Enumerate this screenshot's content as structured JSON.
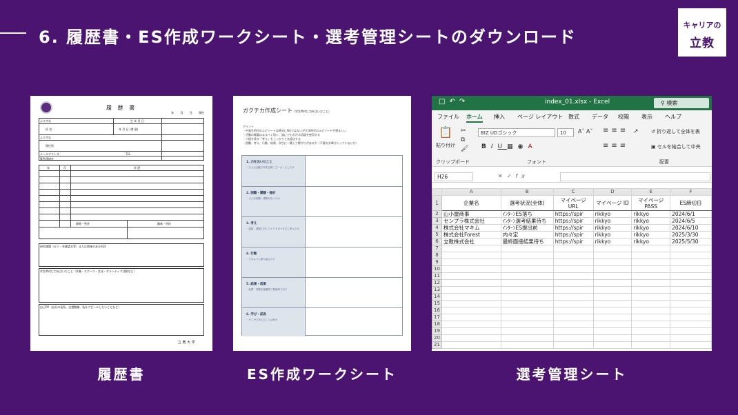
{
  "slide": {
    "title": "6. 履歴書・ES作成ワークシート・選考管理シートのダウンロード",
    "logo_line1": "キャリアの",
    "logo_line2": "立教"
  },
  "captions": {
    "resume": "履歴書",
    "es_sheet": "ES作成ワークシート",
    "tracker": "選考管理シート"
  },
  "resume": {
    "heading": "履 歴 書",
    "date": "年 月 日 現在",
    "furigana": "ふりがな",
    "name": "氏 名",
    "birth": "生 年 月 日",
    "birth_fields": "年 月 日 (満 歳)",
    "address": "現住所",
    "email": "メールアドレス",
    "tel": "TEL",
    "emergency": "緊急連絡先",
    "table_year": "年",
    "table_month": "月",
    "table_history": "学 歴",
    "license": "資格・免許",
    "hobby": "趣味・特技",
    "seminar": "研究課題（ゼミ・卒業論文等）または興味のある科目",
    "gakuchika": "学生時代に力を注いだこと（学業・スポーツ・文化・ボランティア活動など）",
    "self_pr": "自己PR（自分の長所、志望動機、私をアピールしたいことなど）",
    "university": "立 教 大 学"
  },
  "es": {
    "title": "ガクチカ作成シート",
    "subtitle": "（学生時代に力を注いだこと）",
    "points_head": "ポイント",
    "points": [
      "・中高生時代のエピソードは絶対にNGではないが大学時代のエピソードが望ましい",
      "・活動の概要はなるべく短く、誰にでもわかる用語を使用する",
      "・人柄を表す「考え」をしっかりと言語化する",
      "・困難、考え、行動、結果、学びに一貫して繋がりがあるか（不要な文章が入っていないか）"
    ],
    "rows": [
      {
        "head": "1. 力を注いだこと",
        "body": "・どんな活動で何を目標（ゴール）にしたか"
      },
      {
        "head": "2. 困難・課題・挫折",
        "body": "・どんな困難・課題があったか"
      },
      {
        "head": "3. 考え",
        "body": "・困難・課題に対してどうするべきだと考えたか"
      },
      {
        "head": "4. 行動",
        "body": "・どのように取り組んだか"
      },
      {
        "head": "5. 結果・成果",
        "body": "・結果・成果を客観的に数値等で示す"
      },
      {
        "head": "6. 学び・成長",
        "body": "・そこから学んだことは何か"
      }
    ]
  },
  "excel": {
    "filename": "index_01.xlsx - Excel",
    "search": "検索",
    "tabs": [
      "ファイル",
      "ホーム",
      "挿入",
      "ページ レイアウト",
      "数式",
      "データ",
      "校閲",
      "表示",
      "ヘルプ"
    ],
    "active_tab": "ホーム",
    "font_name": "BIZ UDゴシック",
    "font_size": "10",
    "paste": "貼り付け",
    "wrap_text": "折り返して全体を表",
    "merge": "セルを結合して中央",
    "groups": [
      "クリップボード",
      "フォント",
      "配置"
    ],
    "name_box": "H26",
    "fx": "fx",
    "columns": [
      "A",
      "B",
      "C",
      "D",
      "E",
      "F"
    ],
    "headers": [
      "企業名",
      "選考状況(全体)",
      "マイページ URL",
      "マイページ ID",
      "マイページ PASS",
      "ES締切日"
    ],
    "rows": [
      [
        "山小屋商事",
        "ｲﾝﾀｰﾝES落ち",
        "https://spir",
        "rikkyo",
        "rikkyo",
        "2024/6/1"
      ],
      [
        "センプラ株式会社",
        "ｲﾝﾀｰﾝ選考結果待ち",
        "https://spir",
        "rikkyo",
        "rikkyo",
        "2024/6/5"
      ],
      [
        "株式会社マキム",
        "ｲﾝﾀｰﾝES提出前",
        "https://spir",
        "rikkyo",
        "rikkyo",
        "2024/6/10"
      ],
      [
        "株式会社Forest",
        "内々定",
        "https://spir",
        "rikkyo",
        "rikkyo",
        "2025/3/30"
      ],
      [
        "立教株式会社",
        "最終面接結果待ち",
        "https://spir",
        "rikkyo",
        "rikkyo",
        "2025/5/30"
      ]
    ],
    "row_numbers": [
      "1",
      "2",
      "3",
      "4",
      "5",
      "6",
      "7",
      "8",
      "9",
      "10",
      "11",
      "12",
      "13",
      "14",
      "15",
      "16",
      "17",
      "18",
      "19",
      "20",
      "21"
    ]
  }
}
